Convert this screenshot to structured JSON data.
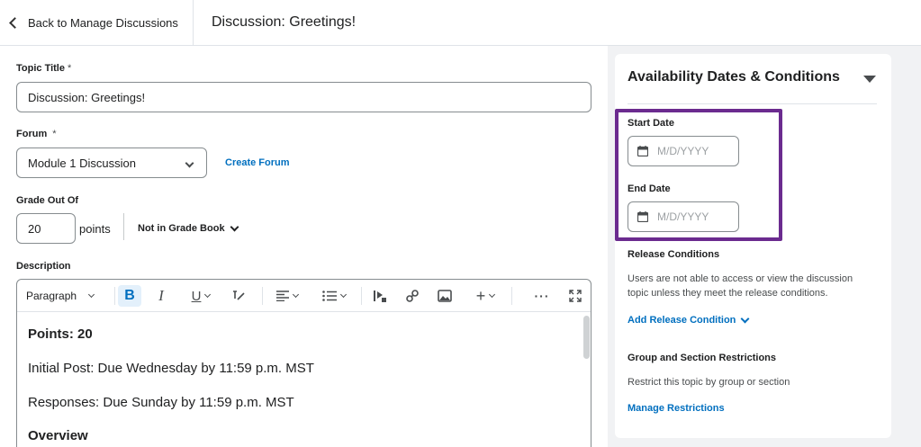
{
  "topbar": {
    "back_label": "Back to Manage Discussions",
    "page_title": "Discussion: Greetings!"
  },
  "form": {
    "topic_title_label": "Topic Title",
    "required_mark": "*",
    "topic_title_value": "Discussion: Greetings!",
    "forum_label": "Forum",
    "forum_value": "Module 1 Discussion",
    "create_forum_link": "Create Forum",
    "grade_label": "Grade Out Of",
    "grade_value": "20",
    "grade_unit": "points",
    "grade_book": "Not in Grade Book",
    "description_label": "Description"
  },
  "editor": {
    "paragraph_format": "Paragraph",
    "toolbar_icons": [
      "bold-icon",
      "italic-icon",
      "underline-icon",
      "text-style-icon",
      "align-icon",
      "list-icon",
      "insert-media-icon",
      "link-icon",
      "image-icon",
      "plus-icon",
      "more-icon",
      "fullscreen-icon"
    ],
    "lines": [
      {
        "text": "Points: 20",
        "bold": true
      },
      {
        "text": "Initial Post: Due Wednesday by 11:59 p.m. MST",
        "bold": false
      },
      {
        "text": "Responses: Due Sunday by 11:59 p.m. MST",
        "bold": false
      },
      {
        "text": "Overview",
        "bold": true
      }
    ]
  },
  "sidebar": {
    "title": "Availability Dates & Conditions",
    "start_date_label": "Start Date",
    "start_date_placeholder": "M/D/YYYY",
    "end_date_label": "End Date",
    "end_date_placeholder": "M/D/YYYY",
    "release_title": "Release Conditions",
    "release_text": "Users are not able to access or view the discussion topic unless they meet the release conditions.",
    "add_release_link": "Add Release Condition",
    "group_title": "Group and Section Restrictions",
    "group_text": "Restrict this topic by group or section",
    "manage_link": "Manage Restrictions"
  },
  "colors": {
    "link": "#006fbf",
    "highlight": "#6b2b8f",
    "active_button": "#e3f0fb"
  }
}
